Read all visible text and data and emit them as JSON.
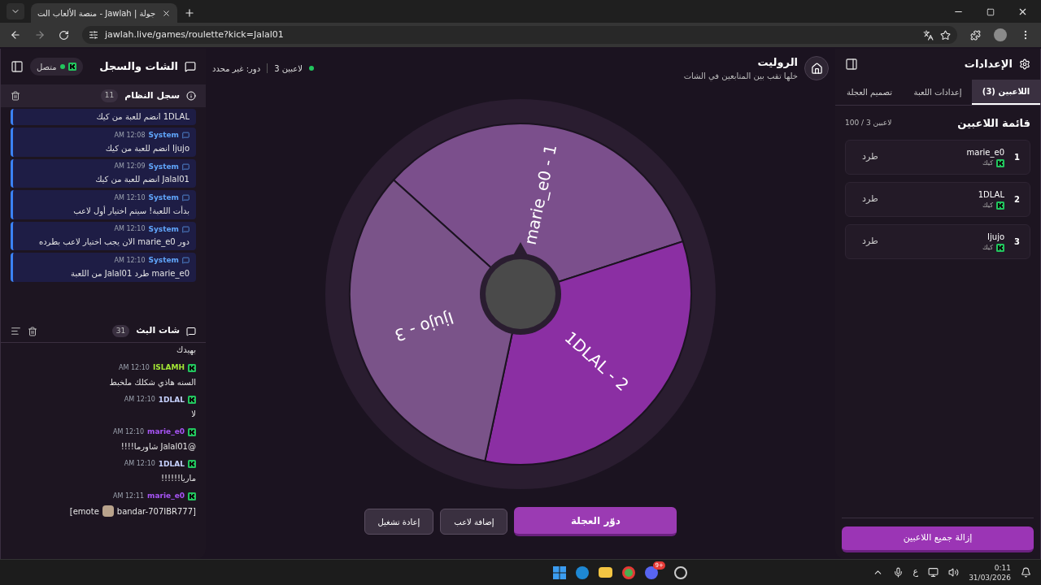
{
  "browser": {
    "tab_title": "جولة | Jawlah - منصة الألعاب الت",
    "url": "jawlah.live/games/roulette?kick=Jalal01"
  },
  "chat_panel": {
    "title": "الشات والسجل",
    "status": "متصل",
    "system_log": {
      "title": "سجل النظام",
      "count": "11",
      "entries": [
        {
          "kind": "continued",
          "text": "1DLAL انضم للعبة من كيك"
        },
        {
          "kind": "entry",
          "sender": "System",
          "time": "12:08 AM",
          "text": "Ijujo انضم للعبة من كيك"
        },
        {
          "kind": "entry",
          "sender": "System",
          "time": "12:09 AM",
          "text": "Jalal01 انضم للعبة من كيك"
        },
        {
          "kind": "entry",
          "sender": "System",
          "time": "12:10 AM",
          "text": "بدأت اللعبة! سيتم اختيار أول لاعب"
        },
        {
          "kind": "entry",
          "sender": "System",
          "time": "12:10 AM",
          "text": "دور marie_e0 الان يجب اختيار لاعب بطرده"
        },
        {
          "kind": "entry",
          "sender": "System",
          "time": "12:10 AM",
          "text": "marie_e0 طرد Jalal01 من اللعبة"
        }
      ]
    },
    "stream_chat": {
      "title": "شات البث",
      "count": "31",
      "messages": [
        {
          "kind": "continued",
          "text": "بهيدك"
        },
        {
          "kind": "text",
          "user": "ISLAMH",
          "color": "#a3e635",
          "time": "12:10 AM",
          "text": "السنه هاذي شكلك ملخبط"
        },
        {
          "kind": "text",
          "user": "1DLAL",
          "color": "#c7d2fe",
          "time": "12:10 AM",
          "text": "لا"
        },
        {
          "kind": "text",
          "user": "marie_e0",
          "color": "#a855f7",
          "time": "12:10 AM",
          "text": "@Jalal01 شاورما!!!!"
        },
        {
          "kind": "text",
          "user": "1DLAL",
          "color": "#c7d2fe",
          "time": "12:10 AM",
          "text": "ماريا!!!!!!"
        },
        {
          "kind": "emote",
          "user": "marie_e0",
          "color": "#a855f7",
          "time": "12:11 AM",
          "text": "[emote",
          "emote_name": "bandar-707IBR777]"
        }
      ]
    }
  },
  "game": {
    "title": "الروليت",
    "subtitle": "خلها تقب بين المتابعين في الشات",
    "players_count": "3 لاعبين",
    "turn": "دور: غير محدد",
    "wheel": {
      "segments": [
        {
          "label": "marie_e0 - 1",
          "color": "#7b4f8c"
        },
        {
          "label": "1DLAL - 2",
          "color": "#8b2fa3"
        },
        {
          "label": "Ijujo - 3",
          "color": "#7a5389"
        }
      ]
    },
    "buttons": {
      "spin": "دوّر العجلة",
      "add_player": "إضافة لاعب",
      "restart": "إعادة تشغيل"
    }
  },
  "settings_panel": {
    "title": "الإعدادات",
    "tabs": [
      {
        "label": "اللاعبين (3)",
        "selected": true
      },
      {
        "label": "إعدادات اللعبة",
        "selected": false
      },
      {
        "label": "تصميم العجلة",
        "selected": false
      }
    ],
    "list_title": "قائمة اللاعبين",
    "capacity": "100 / 3 لاعبين",
    "players": [
      {
        "number": "1",
        "name": "marie_e0",
        "platform": "كيك",
        "action": "طرد"
      },
      {
        "number": "2",
        "name": "1DLAL",
        "platform": "كيك",
        "action": "طرد"
      },
      {
        "number": "3",
        "name": "Ijujo",
        "platform": "كيك",
        "action": "طرد"
      }
    ],
    "clear_button": "إزالة جميع اللاعبين"
  },
  "taskbar": {
    "discord_badge": "9+",
    "language": "ع",
    "time": "0:11",
    "date": "31/03/2026"
  }
}
